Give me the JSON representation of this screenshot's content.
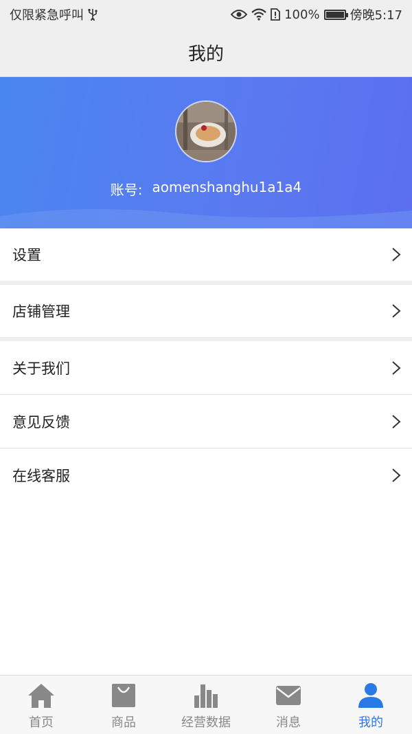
{
  "status_bar": {
    "carrier": "仅限紧急呼叫",
    "battery_percent": "100%",
    "time": "傍晚5:17",
    "battery_level": 1.0,
    "icons": [
      "usb-icon",
      "eye-icon",
      "wifi-icon",
      "sim-icon",
      "battery-icon"
    ]
  },
  "header": {
    "title": "我的"
  },
  "profile": {
    "account_label": "账号:",
    "account_value": "aomenshanghu1a1a4"
  },
  "menu": {
    "items": [
      {
        "label": "设置"
      },
      {
        "label": "店铺管理"
      },
      {
        "label": "关于我们"
      },
      {
        "label": "意见反馈"
      },
      {
        "label": "在线客服"
      }
    ]
  },
  "tabbar": {
    "tabs": [
      {
        "label": "首页",
        "icon": "home-icon"
      },
      {
        "label": "商品",
        "icon": "shopping-bag-icon"
      },
      {
        "label": "经营数据",
        "icon": "bar-chart-icon"
      },
      {
        "label": "消息",
        "icon": "mail-icon"
      },
      {
        "label": "我的",
        "icon": "user-icon",
        "active": true
      }
    ]
  },
  "colors": {
    "accent": "#2a79e6",
    "gradient_start": "#4a86f0",
    "gradient_end": "#5b6ff0",
    "tab_inactive": "#888888"
  }
}
